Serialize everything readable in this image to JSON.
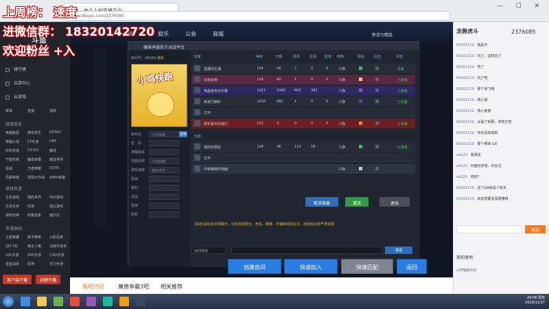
{
  "browser": {
    "tab_title": "斗鱼 - 每个人的直播平台",
    "url": "www.douyu.com/2376085",
    "window_controls": "— ☐ ✕"
  },
  "overlay": {
    "line1": "上周榜： 速度",
    "line2": "进微信群： 18320142720",
    "line3": "欢迎粉丝 +入"
  },
  "site_sidebar": {
    "items": [
      {
        "label": "排行榜",
        "icon": "chart-icon"
      },
      {
        "label": "云游中心",
        "icon": "cloud-icon"
      },
      {
        "label": "云游戏",
        "icon": "gamepad-icon"
      }
    ],
    "quick": [
      "赛事",
      "直播",
      "视频"
    ],
    "section1": "网游竞技",
    "grid1": [
      "英雄联盟",
      "绝地求生",
      "DOTA2",
      "穿越火线",
      "CF手游",
      "DNF",
      "炉石传说",
      "CS:GO",
      "魔兽",
      "守望先锋",
      "魔兽争霸",
      "魔兽世界",
      "逆战",
      "王者荣耀",
      "DOTA",
      "风暴英雄",
      "球球大作战",
      "APEX英雄"
    ],
    "section2": "单机热游",
    "grid2": [
      "主机游戏",
      "我的世界",
      "怀旧游戏",
      "方舟生存",
      "饥荒",
      "独立游戏",
      "使命召唤",
      "刺客信条",
      "塞尔达"
    ],
    "section3": "手游休闲",
    "grid3": [
      "王者荣耀",
      "和平精英",
      "火影忍者",
      "QQ飞车",
      "第五人格",
      "决战平安京",
      "LOL手游",
      "炉石手游",
      "COD手游",
      "皇室战争",
      "原神",
      "天刀手游"
    ],
    "btn_download": "客户端下载",
    "btn_open": "创建开播"
  },
  "site_nav": {
    "items": [
      "游戏",
      "娱乐",
      "公会",
      "商城"
    ],
    "right": "新游力精选"
  },
  "client": {
    "title": "魔兽争霸官方对战平台",
    "room_label": "房间号：",
    "room_no": "A8266",
    "room_tag": "游戏",
    "map_title": "小鸡快跑",
    "fields": [
      "房间名",
      "密　码",
      "地图版本",
      "地图名称",
      "游戏速度",
      "观战",
      "裁判",
      "追加",
      "录像",
      "随机"
    ],
    "field_values": [
      "小鸡快跑",
      "",
      "",
      "小鸡快跑",
      "游戏大厅",
      "",
      "",
      "",
      "",
      ""
    ],
    "btn_change": "更换",
    "headers": [
      "玩家",
      "等级",
      "天梯",
      "胜场",
      "总场",
      "胜率",
      "种族",
      "颜色",
      "队伍",
      "状态"
    ],
    "section_obs": "玩家",
    "rows_top": [
      {
        "name": "直播间主播",
        "lv": "LV4",
        "score": "16",
        "w": "7",
        "t": "0",
        "r": "0",
        "race": "人族",
        "color": "#38c050",
        "status": "准备"
      },
      {
        "name": "玩家名称",
        "lv": "LV4",
        "score": "40",
        "w": "1",
        "t": "0",
        "r": "0",
        "race": "人族",
        "color": "#f5d23c",
        "status": "已准备"
      },
      {
        "name": "陶晶莹有点无聊",
        "lv": "LV21",
        "score": "1069",
        "w": "605",
        "t": "392",
        "r": "",
        "race": "人族",
        "color": "#b040c0",
        "status": "已准备"
      },
      {
        "name": "新游力精彩",
        "lv": "LV16",
        "score": "492",
        "w": "1",
        "t": "0",
        "r": "0",
        "race": "人族",
        "color": "#6040c0",
        "status": "已准备"
      },
      {
        "name": "打开",
        "lv": "",
        "score": "",
        "w": "",
        "t": "",
        "r": "",
        "race": "",
        "color": "",
        "status": ""
      },
      {
        "name": "那年夏天的我们",
        "lv": "LV2",
        "score": "3",
        "w": "0",
        "t": "0",
        "r": "0",
        "race": "人族",
        "color": "#f08030",
        "status": "已准备"
      }
    ],
    "rows_bottom": [
      {
        "name": "我的好朋友",
        "lv": "LV9",
        "score": "46",
        "w": "110",
        "t": "16",
        "r": "",
        "race": "人族",
        "color": "#38c050",
        "status": "已准备"
      },
      {
        "name": "打开",
        "lv": "",
        "score": "",
        "w": "",
        "t": "",
        "r": "",
        "race": "",
        "color": "",
        "status": ""
      },
      {
        "name": "中等难度的电脑",
        "lv": "",
        "score": "",
        "w": "",
        "t": "",
        "r": "",
        "race": "人族",
        "color": "#c8c8c8",
        "status": ""
      }
    ],
    "warn_text": "[系统]请玩家文明聊天，切勿发送政治、色情、赌博、诈骗等违规言论，违规者必将严肃处理",
    "btn_cancel_ready": "取消准备",
    "btn_ready": "邀请",
    "btn_exit": "退出",
    "channel": "房间频道",
    "send": "发送",
    "btn_create": "创建房间",
    "btn_quick_join": "快速加入",
    "btn_match": "快速匹配",
    "btn_back": "返回"
  },
  "chat": {
    "streamer": "龙兽虎斗",
    "fans": "2376085",
    "lines": [
      {
        "u": "69191213：",
        "m": "她是不"
      },
      {
        "u": "69191213：",
        "m": "玩了，这样玩了"
      },
      {
        "u": "69191213：",
        "m": "吃了"
      },
      {
        "u": "69191213：",
        "m": "玩了吧"
      },
      {
        "u": "69191213：",
        "m": "那个张飞哦"
      },
      {
        "u": "69191213：",
        "m": "我小弟"
      },
      {
        "u": "69191213：",
        "m": "我小弟弟"
      },
      {
        "u": "69191213：",
        "m": "太猛了就那，单他已死"
      },
      {
        "u": "69191213：",
        "m": "你玩没有成就"
      },
      {
        "u": "69191213：",
        "m": "那个哪来 GA"
      },
      {
        "u": "ad123：",
        "m": "我真是"
      },
      {
        "u": "ad123：",
        "m": "对面好多兽，炉台位"
      },
      {
        "u": "ad123：",
        "m": "死掉？"
      },
      {
        "u": "69191213：",
        "m": "这个GA就是个兽夫"
      },
      {
        "u": "69191213：",
        "m": "就这样都没事置懂得"
      }
    ],
    "send_btn": "发送",
    "fans_label": "我的发明",
    "bottom_item": "小开始的大片"
  },
  "below_stream": {
    "items": [
      "鱼吧讨论",
      "魔兽争霸3吧",
      "相关推荐"
    ]
  },
  "taskbar": {
    "time": "20:06 周日",
    "date": "2019/11/17"
  }
}
